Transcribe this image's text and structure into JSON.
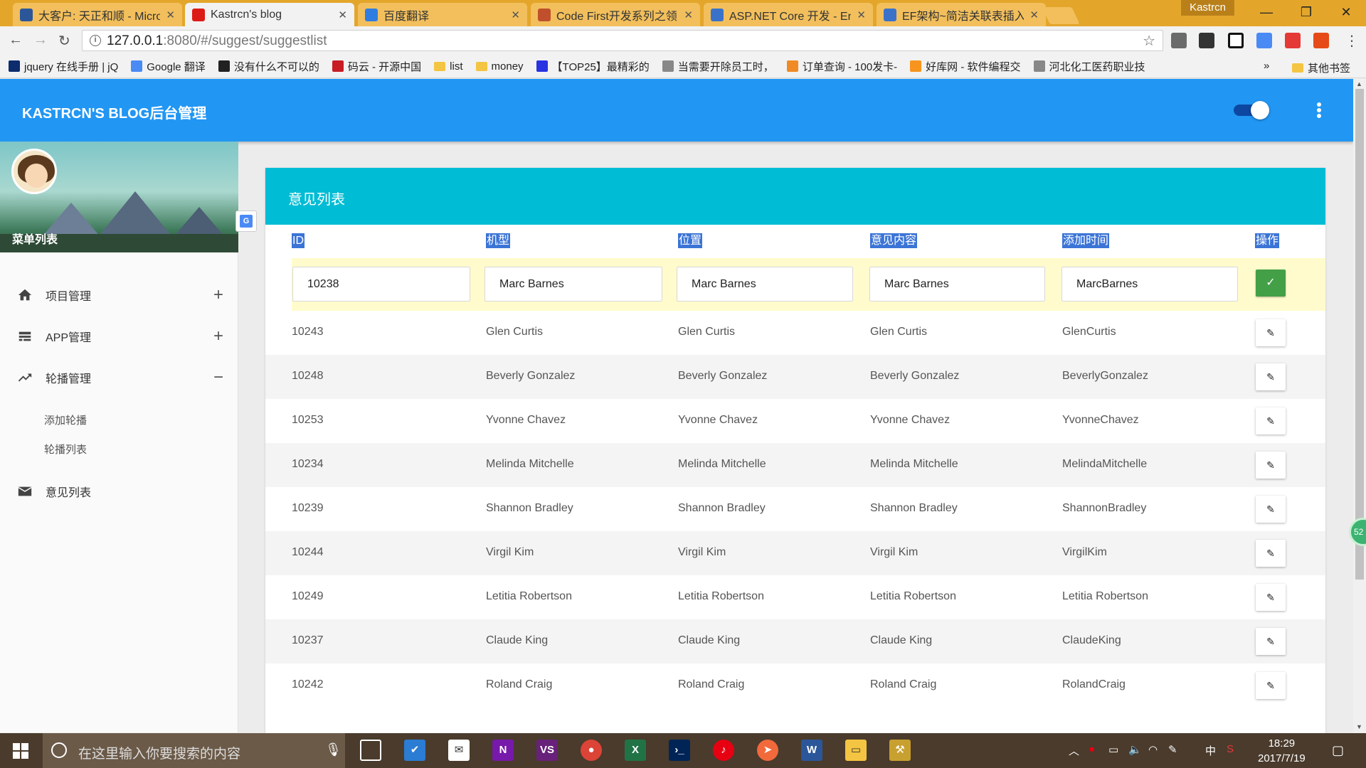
{
  "browser": {
    "tabs": [
      {
        "title": "大客户: 天正和顺 - Micro",
        "favicon_color": "#2b579a"
      },
      {
        "title": "Kastrcn's blog",
        "favicon_color": "#dd1b16",
        "active": true
      },
      {
        "title": "百度翻译",
        "favicon_color": "#2f7de1"
      },
      {
        "title": "Code First开发系列之领",
        "favicon_color": "#c0502b"
      },
      {
        "title": "ASP.NET Core 开发 - En",
        "favicon_color": "#3a72c9"
      },
      {
        "title": "EF架构~简洁关联表插入",
        "favicon_color": "#3a72c9"
      }
    ],
    "profile_name": "Kastrcn",
    "url_host": "127.0.0.1",
    "url_path": ":8080/#/suggest/suggestlist",
    "bookmarks": [
      {
        "label": "jquery 在线手册 | jQ",
        "icon_color": "#0d2c6d"
      },
      {
        "label": "Google 翻译",
        "icon_color": "#4a8af4"
      },
      {
        "label": "没有什么不可以的",
        "icon_color": "#222222"
      },
      {
        "label": "码云 - 开源中国",
        "icon_color": "#c71d23"
      },
      {
        "label": "list",
        "icon_color": "#f4c542",
        "folder": true
      },
      {
        "label": "money",
        "icon_color": "#f4c542",
        "folder": true
      },
      {
        "label": "【TOP25】最精彩的",
        "icon_color": "#2932e1"
      },
      {
        "label": "当需要开除员工时，",
        "icon_color": "#888888"
      },
      {
        "label": "订单查询 - 100发卡-",
        "icon_color": "#f08a24"
      },
      {
        "label": "好库网 - 软件编程交",
        "icon_color": "#f7941d"
      },
      {
        "label": "河北化工医药职业技",
        "icon_color": "#888888"
      }
    ],
    "bookmarks_overflow": "»",
    "other_bookmarks": "其他书签"
  },
  "app": {
    "brand": "KASTRCN'S BLOG后台管理",
    "primary_color": "#2196f3",
    "card_header_color": "#00bcd4"
  },
  "sidebar": {
    "caption": "菜单列表",
    "items": [
      {
        "label": "项目管理",
        "icon": "home-icon",
        "expander": "+"
      },
      {
        "label": "APP管理",
        "icon": "view-list-icon",
        "expander": "+"
      },
      {
        "label": "轮播管理",
        "icon": "trending-up-icon",
        "expander": "−"
      },
      {
        "label": "意见列表",
        "icon": "mail-icon",
        "expander": ""
      }
    ],
    "subitems": [
      "添加轮播",
      "轮播列表"
    ]
  },
  "suggest_list": {
    "title": "意见列表",
    "columns": [
      "ID",
      "机型",
      "位置",
      "意见内容",
      "添加时间",
      "操作"
    ],
    "editing_row": {
      "id": "10238",
      "model": "Marc Barnes",
      "position": "Marc Barnes",
      "content": "Marc Barnes",
      "time": "MarcBarnes"
    },
    "save_glyph": "✓",
    "edit_glyph": "✎",
    "rows": [
      {
        "id": "10243",
        "model": "Glen Curtis",
        "position": "Glen Curtis",
        "content": "Glen Curtis",
        "time": "GlenCurtis"
      },
      {
        "id": "10248",
        "model": "Beverly Gonzalez",
        "position": "Beverly Gonzalez",
        "content": "Beverly Gonzalez",
        "time": "BeverlyGonzalez"
      },
      {
        "id": "10253",
        "model": "Yvonne Chavez",
        "position": "Yvonne Chavez",
        "content": "Yvonne Chavez",
        "time": "YvonneChavez"
      },
      {
        "id": "10234",
        "model": "Melinda Mitchelle",
        "position": "Melinda Mitchelle",
        "content": "Melinda Mitchelle",
        "time": "MelindaMitchelle"
      },
      {
        "id": "10239",
        "model": "Shannon Bradley",
        "position": "Shannon Bradley",
        "content": "Shannon Bradley",
        "time": "ShannonBradley"
      },
      {
        "id": "10244",
        "model": "Virgil Kim",
        "position": "Virgil Kim",
        "content": "Virgil Kim",
        "time": "VirgilKim"
      },
      {
        "id": "10249",
        "model": "Letitia Robertson",
        "position": "Letitia Robertson",
        "content": "Letitia Robertson",
        "time": "Letitia Robertson"
      },
      {
        "id": "10237",
        "model": "Claude King",
        "position": "Claude King",
        "content": "Claude King",
        "time": "ClaudeKing"
      },
      {
        "id": "10242",
        "model": "Roland Craig",
        "position": "Roland Craig",
        "content": "Roland Craig",
        "time": "RolandCraig"
      }
    ]
  },
  "floating_badge": "52",
  "taskbar": {
    "search_placeholder": "在这里输入你要搜索的内容",
    "ime": "中",
    "time": "18:29",
    "date": "2017/7/19"
  }
}
